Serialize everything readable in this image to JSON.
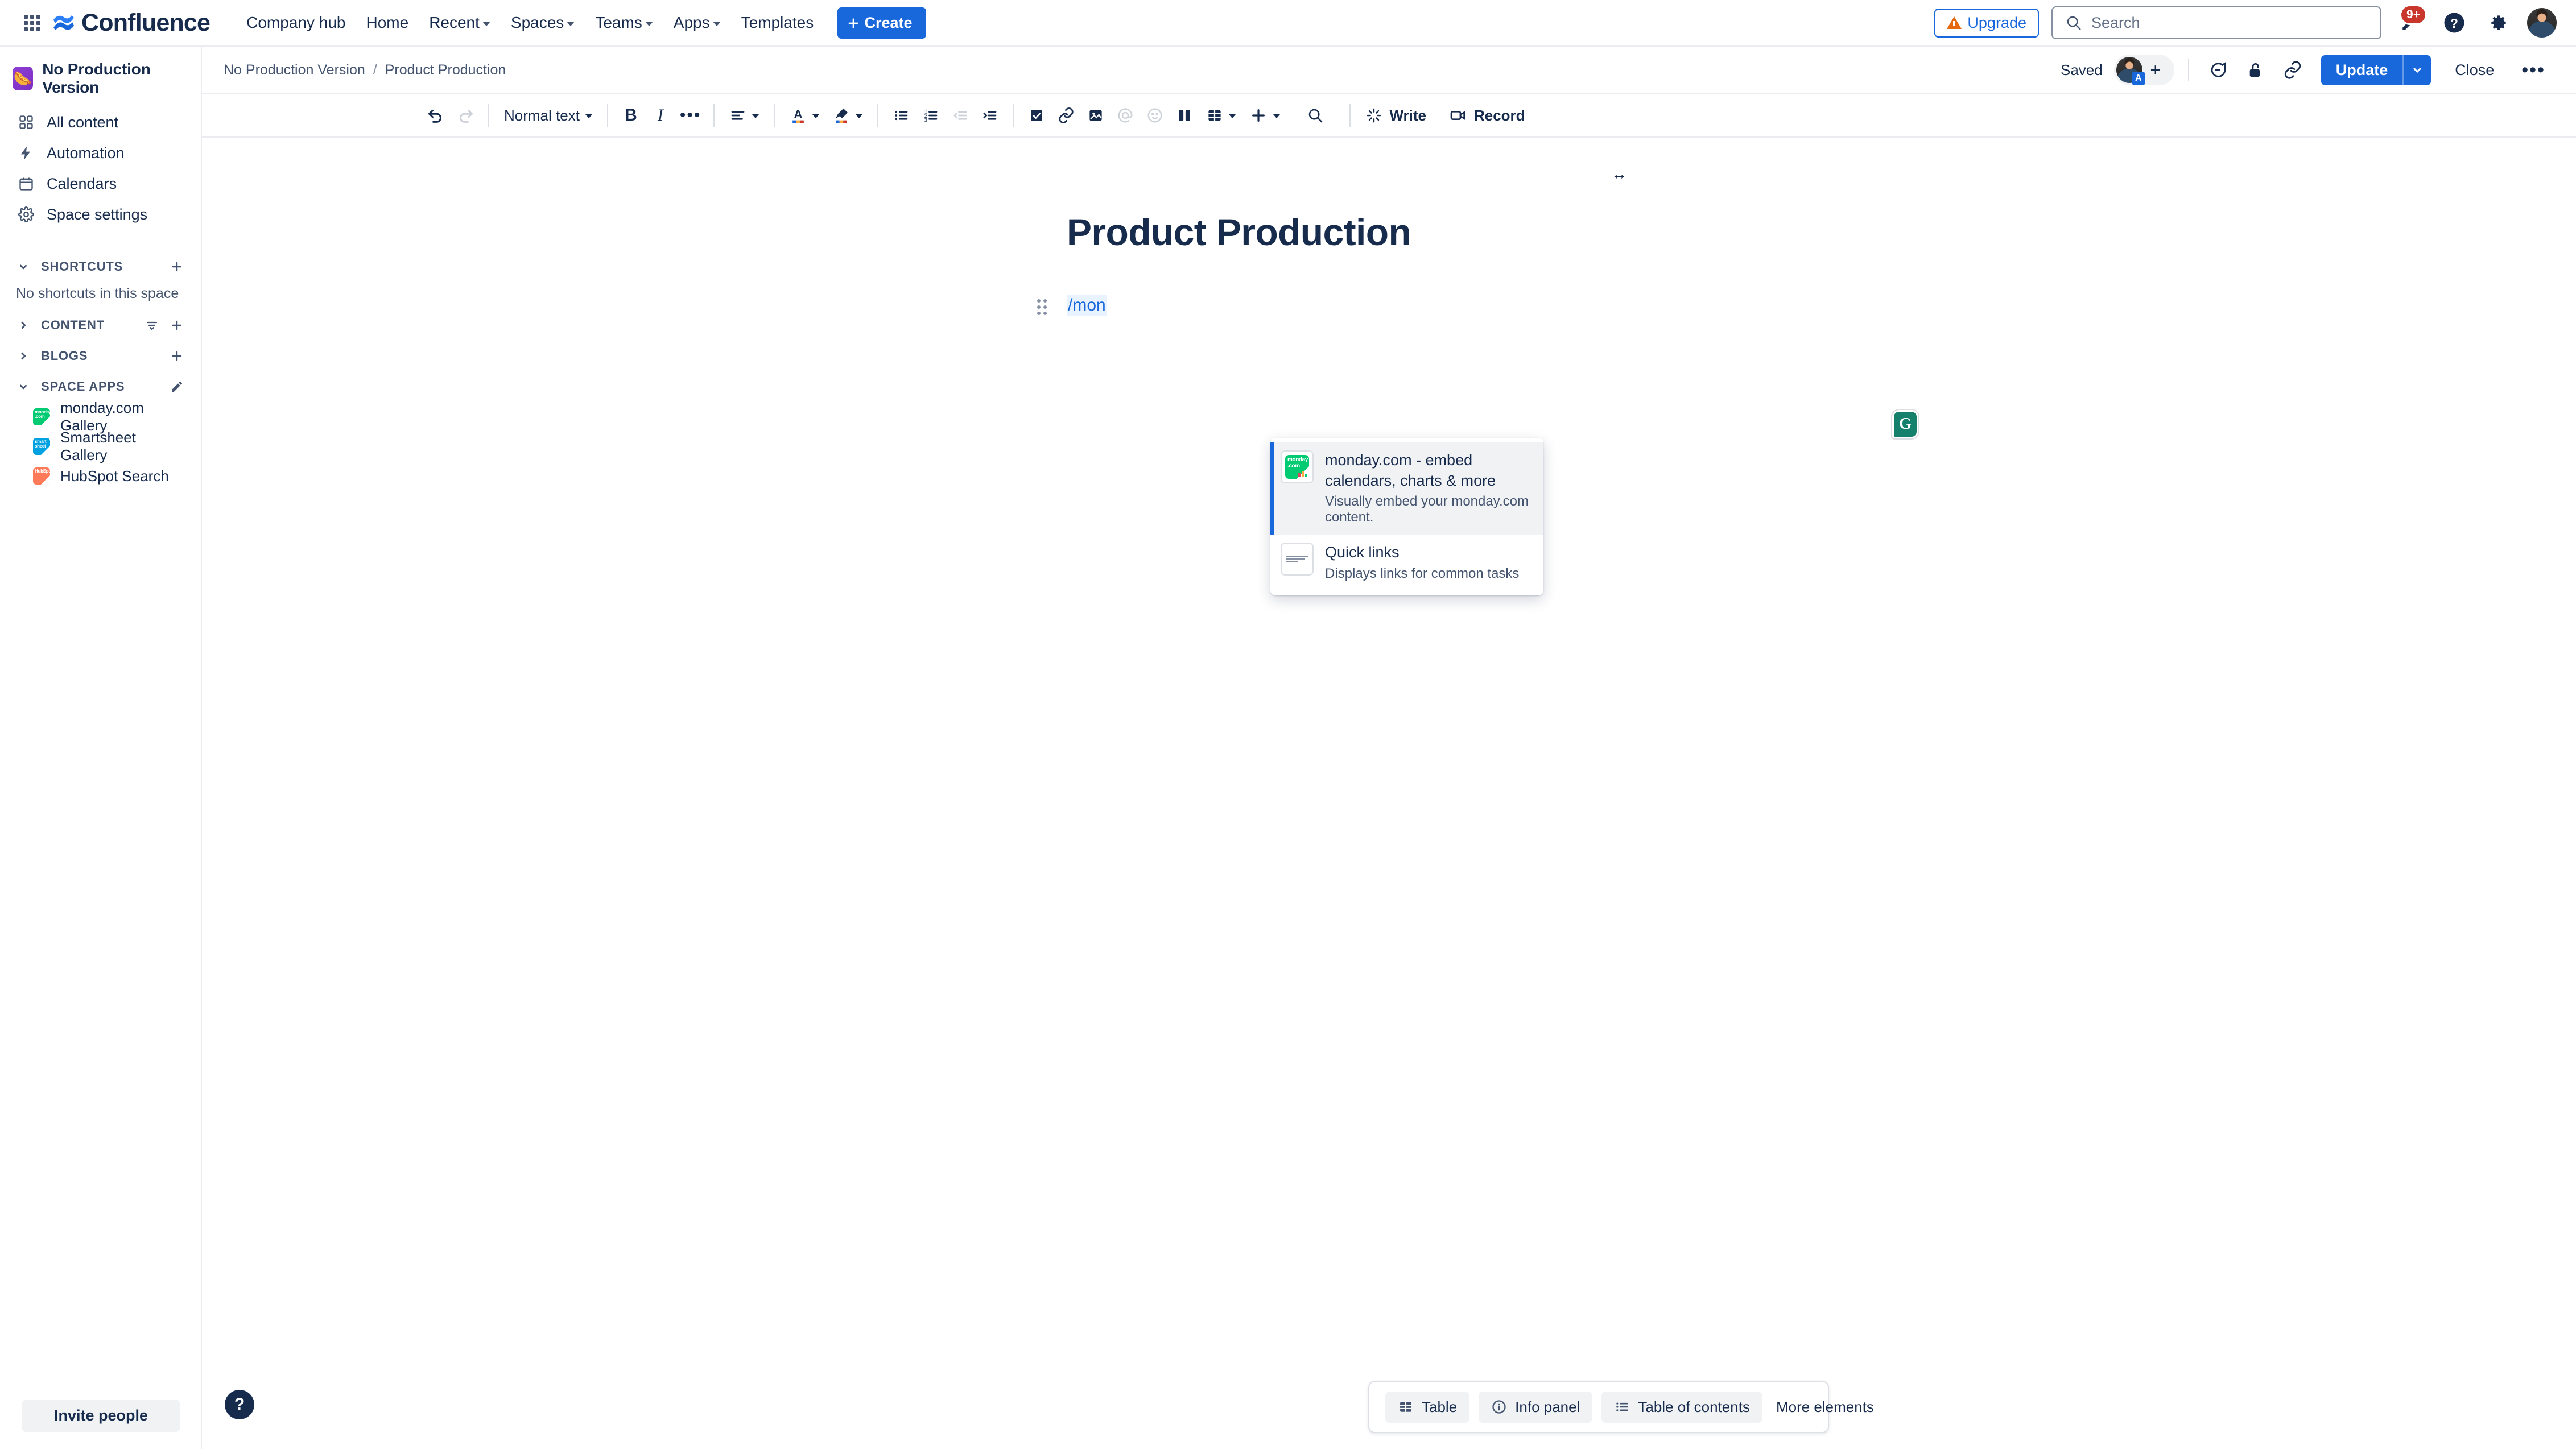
{
  "topnav": {
    "app_switcher_icon": "grid-apps-icon",
    "brand": "Confluence",
    "links": [
      {
        "label": "Company hub",
        "has_caret": false
      },
      {
        "label": "Home",
        "has_caret": false
      },
      {
        "label": "Recent",
        "has_caret": true
      },
      {
        "label": "Spaces",
        "has_caret": true
      },
      {
        "label": "Teams",
        "has_caret": true
      },
      {
        "label": "Apps",
        "has_caret": true
      },
      {
        "label": "Templates",
        "has_caret": false
      }
    ],
    "create_label": "Create",
    "upgrade_label": "Upgrade",
    "search_placeholder": "Search",
    "notification_badge": "9+",
    "icons": [
      "notification-bell-icon",
      "help-icon",
      "settings-gear-icon",
      "user-avatar"
    ],
    "accent_blue": "#1868DB",
    "badge_red": "#C9372C",
    "upgrade_orange": "#E56910"
  },
  "sidebar": {
    "space_name": "No Production Version",
    "space_emoji": "🌭",
    "nav_items": [
      {
        "label": "All content",
        "icon": "grid-content-icon"
      },
      {
        "label": "Automation",
        "icon": "lightning-bolt-icon"
      },
      {
        "label": "Calendars",
        "icon": "calendar-icon"
      },
      {
        "label": "Space settings",
        "icon": "gear-icon"
      }
    ],
    "sections": [
      {
        "label": "SHORTCUTS",
        "expanded": true,
        "empty_text": "No shortcuts in this space",
        "actions": [
          "add-icon"
        ]
      },
      {
        "label": "CONTENT",
        "expanded": false,
        "actions": [
          "filter-icon",
          "add-icon"
        ]
      },
      {
        "label": "BLOGS",
        "expanded": false,
        "actions": [
          "add-icon"
        ]
      },
      {
        "label": "SPACE APPS",
        "expanded": true,
        "actions": [
          "edit-pencil-icon"
        ]
      }
    ],
    "space_apps": [
      {
        "label": "monday.com Gallery",
        "icon": "monday-app-icon",
        "icon_text": "monday .com"
      },
      {
        "label": "Smartsheet Gallery",
        "icon": "smartsheet-app-icon",
        "icon_text": "smart sheet"
      },
      {
        "label": "HubSpot Search",
        "icon": "hubspot-app-icon",
        "icon_text": "HubSpot"
      }
    ],
    "invite_label": "Invite people"
  },
  "pagebar": {
    "breadcrumb": [
      {
        "label": "No Production Version"
      },
      {
        "label": "Product Production"
      }
    ],
    "breadcrumb_separator": "/",
    "status": "Saved",
    "collab_avatar_badge": "A",
    "add_collaborator_icon": "plus-icon",
    "icons": [
      "comment-icon",
      "page-restrictions-lock-icon",
      "copy-link-icon"
    ],
    "update_label": "Update",
    "update_dropdown_icon": "chevron-down-icon",
    "close_label": "Close",
    "more_label": "•••"
  },
  "toolbar": {
    "undo_icon": "undo-icon",
    "redo_icon": "redo-icon",
    "text_style": "Normal text",
    "bold": "B",
    "italic": "I",
    "more_formatting": "•••",
    "items": [
      {
        "name": "text-color-icon",
        "label": "A"
      },
      {
        "name": "highlight-color-icon",
        "label": ""
      },
      {
        "name": "bullet-list-icon",
        "label": ""
      },
      {
        "name": "numbered-list-icon",
        "label": ""
      },
      {
        "name": "outdent-icon",
        "label": ""
      },
      {
        "name": "indent-icon",
        "label": ""
      },
      {
        "name": "task-checkbox-icon",
        "label": ""
      },
      {
        "name": "link-icon",
        "label": ""
      },
      {
        "name": "image-icon",
        "label": ""
      },
      {
        "name": "mention-icon",
        "label": "@"
      },
      {
        "name": "emoji-icon",
        "label": ""
      },
      {
        "name": "layouts-icon",
        "label": ""
      },
      {
        "name": "table-icon",
        "label": ""
      },
      {
        "name": "insert-more-icon",
        "label": ""
      },
      {
        "name": "find-replace-icon",
        "label": ""
      }
    ],
    "write_label": "Write",
    "record_label": "Record"
  },
  "editor": {
    "title": "Product Production",
    "paragraph_text": "/mon",
    "resize_marker": "↔",
    "grammarly_letter": "G"
  },
  "slash_menu": {
    "items": [
      {
        "title": "monday.com - embed calendars, charts & more",
        "description": "Visually embed your monday.com content.",
        "icon": "monday-com-icon",
        "active": true
      },
      {
        "title": "Quick links",
        "description": "Displays links for common tasks",
        "icon": "quick-links-icon",
        "active": false
      }
    ]
  },
  "insert_bar": {
    "buttons": [
      {
        "label": "Table",
        "icon": "table-icon"
      },
      {
        "label": "Info panel",
        "icon": "info-circle-icon"
      },
      {
        "label": "Table of contents",
        "icon": "list-icon"
      }
    ],
    "more_label": "More elements"
  },
  "help_fab": {
    "label": "?",
    "icon": "help-question-icon"
  }
}
